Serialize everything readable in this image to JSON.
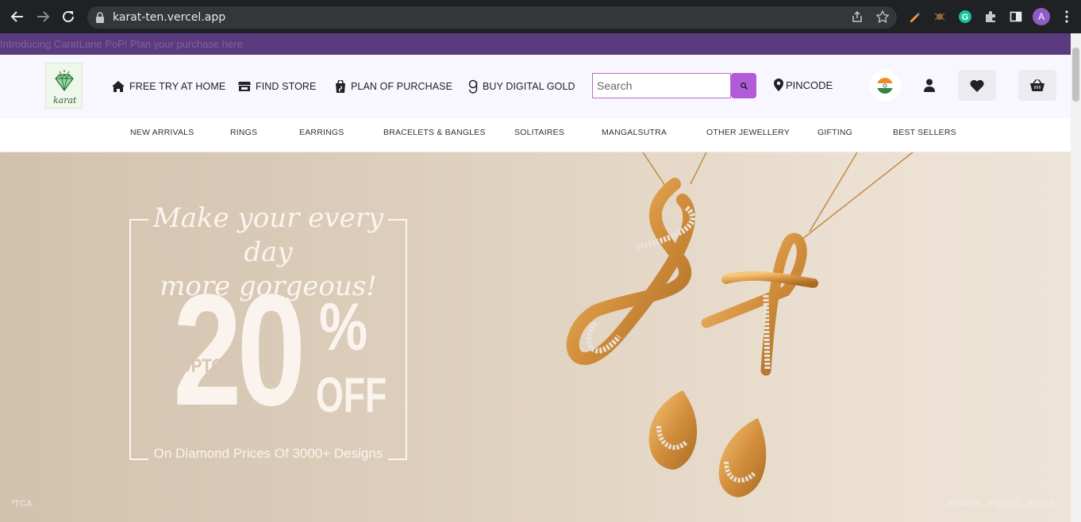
{
  "browser": {
    "url": "karat-ten.vercel.app",
    "profile_initial": "A"
  },
  "announcement": "Introducing CaratLane PoP! Plan your purchase here",
  "header": {
    "logo_text": "karat",
    "nav": [
      {
        "label": "FREE TRY AT HOME",
        "icon": "home-icon"
      },
      {
        "label": "FIND STORE",
        "icon": "store-icon"
      },
      {
        "label": "PLAN OF PURCHASE",
        "icon": "shopping-bag-icon"
      },
      {
        "label": "BUY DIGITAL GOLD",
        "icon": "gold-icon"
      }
    ],
    "search_placeholder": "Search",
    "pincode_label": "PINCODE"
  },
  "categories": [
    "NEW ARRIVALS",
    "RINGS",
    "EARRINGS",
    "BRACELETS & BANGLES",
    "SOLITAIRES",
    "MANGALSUTRA",
    "OTHER JEWELLERY",
    "GIFTING",
    "BEST SELLERS"
  ],
  "hero": {
    "title_line1": "Make your every day",
    "title_line2": "more gorgeous!",
    "upto": "UPTO",
    "big_number": "20",
    "percent": "%",
    "off": "OFF",
    "subtitle": "On Diamond Prices Of 3000+ Designs",
    "tca": "*TCA",
    "codes": "JP03065, JP00793, JE06182"
  },
  "colors": {
    "accent": "#b15bd9",
    "announcement_bg": "#5b3a7e",
    "header_bg": "#f8f6ff"
  }
}
